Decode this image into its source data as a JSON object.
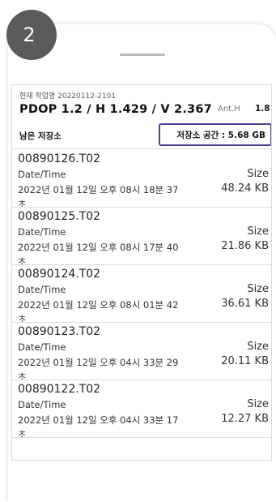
{
  "step_badge": "2",
  "header": {
    "job_label": "현재 작업명 20220112-2101",
    "dop_text": "PDOP 1.2 / H 1.429 / V 2.367",
    "anth_label": "Ant.H",
    "anth_value": "1.8"
  },
  "storage": {
    "remaining_label": "남은 저장소",
    "space_text": "저장소 공간 : 5.68 GB"
  },
  "files": [
    {
      "name": "00890126.T02",
      "dt_label": "Date/Time",
      "dt_value": "2022년 01월 12일 오후 08시 18분 37초",
      "size_label": "Size",
      "size_value": "48.24 KB"
    },
    {
      "name": "00890125.T02",
      "dt_label": "Date/Time",
      "dt_value": "2022년 01월 12일 오후 08시 17분 40초",
      "size_label": "Size",
      "size_value": "21.86 KB"
    },
    {
      "name": "00890124.T02",
      "dt_label": "Date/Time",
      "dt_value": "2022년 01월 12일 오후 08시 01분 42초",
      "size_label": "Size",
      "size_value": "36.61 KB"
    },
    {
      "name": "00890123.T02",
      "dt_label": "Date/Time",
      "dt_value": "2022년 01월 12일 오후 04시 33분 29초",
      "size_label": "Size",
      "size_value": "20.11 KB"
    },
    {
      "name": "00890122.T02",
      "dt_label": "Date/Time",
      "dt_value": "2022년 01월 12일 오후 04시 33분 17초",
      "size_label": "Size",
      "size_value": "12.27 KB"
    }
  ]
}
